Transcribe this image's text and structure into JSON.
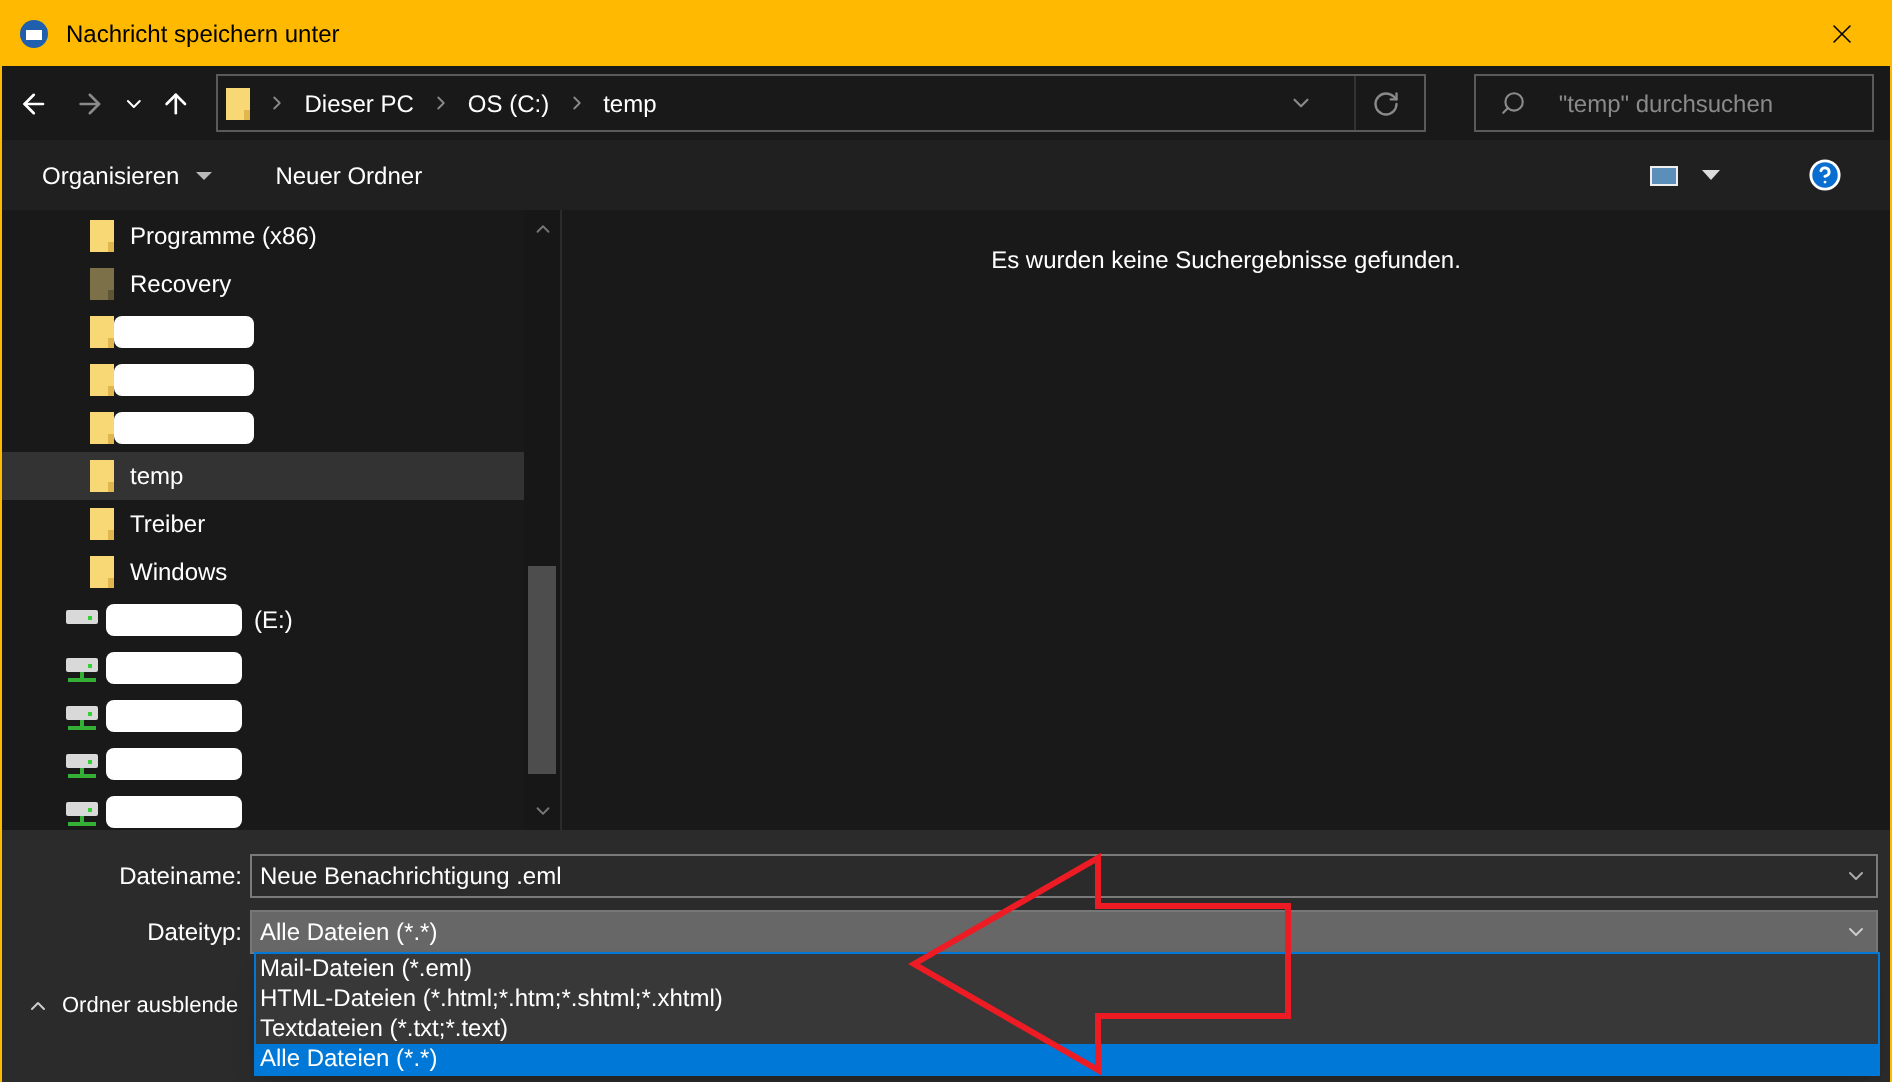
{
  "window": {
    "title": "Nachricht speichern unter"
  },
  "address_bar": {
    "segments": [
      "Dieser PC",
      "OS (C:)",
      "temp"
    ]
  },
  "search": {
    "placeholder": "\"temp\" durchsuchen"
  },
  "toolbar": {
    "organize": "Organisieren",
    "new_folder": "Neuer Ordner"
  },
  "tree": [
    {
      "kind": "folder",
      "label": "Programme (x86)",
      "selected": false,
      "redacted": false
    },
    {
      "kind": "hidden_folder",
      "label": "Recovery",
      "selected": false,
      "redacted": false
    },
    {
      "kind": "folder",
      "selected": false,
      "redacted": true
    },
    {
      "kind": "folder",
      "selected": false,
      "redacted": true
    },
    {
      "kind": "folder",
      "selected": false,
      "redacted": true
    },
    {
      "kind": "folder",
      "label": "temp",
      "selected": true,
      "redacted": false
    },
    {
      "kind": "folder",
      "label": "Treiber",
      "selected": false,
      "redacted": false
    },
    {
      "kind": "folder",
      "label": "Windows",
      "selected": false,
      "redacted": false
    },
    {
      "kind": "drive",
      "label": "(E:)",
      "selected": false,
      "redacted": true
    },
    {
      "kind": "network_drive",
      "selected": false,
      "redacted": true
    },
    {
      "kind": "network_drive",
      "selected": false,
      "redacted": true
    },
    {
      "kind": "network_drive",
      "selected": false,
      "redacted": true
    },
    {
      "kind": "network_drive",
      "selected": false,
      "redacted": true
    }
  ],
  "content": {
    "message": "Es wurden keine Suchergebnisse gefunden."
  },
  "filename": {
    "label": "Dateiname:",
    "value": "Neue Benachrichtigung .eml"
  },
  "filetype": {
    "label": "Dateityp:",
    "value": "Alle Dateien (*.*)",
    "expanded": true,
    "options": [
      {
        "label": "Mail-Dateien (*.eml)",
        "selected": false
      },
      {
        "label": "HTML-Dateien (*.html;*.htm;*.shtml;*.xhtml)",
        "selected": false
      },
      {
        "label": "Textdateien (*.txt;*.text)",
        "selected": false
      },
      {
        "label": "Alle Dateien (*.*)",
        "selected": true
      }
    ]
  },
  "hide_folders": {
    "label": "Ordner ausblende"
  }
}
